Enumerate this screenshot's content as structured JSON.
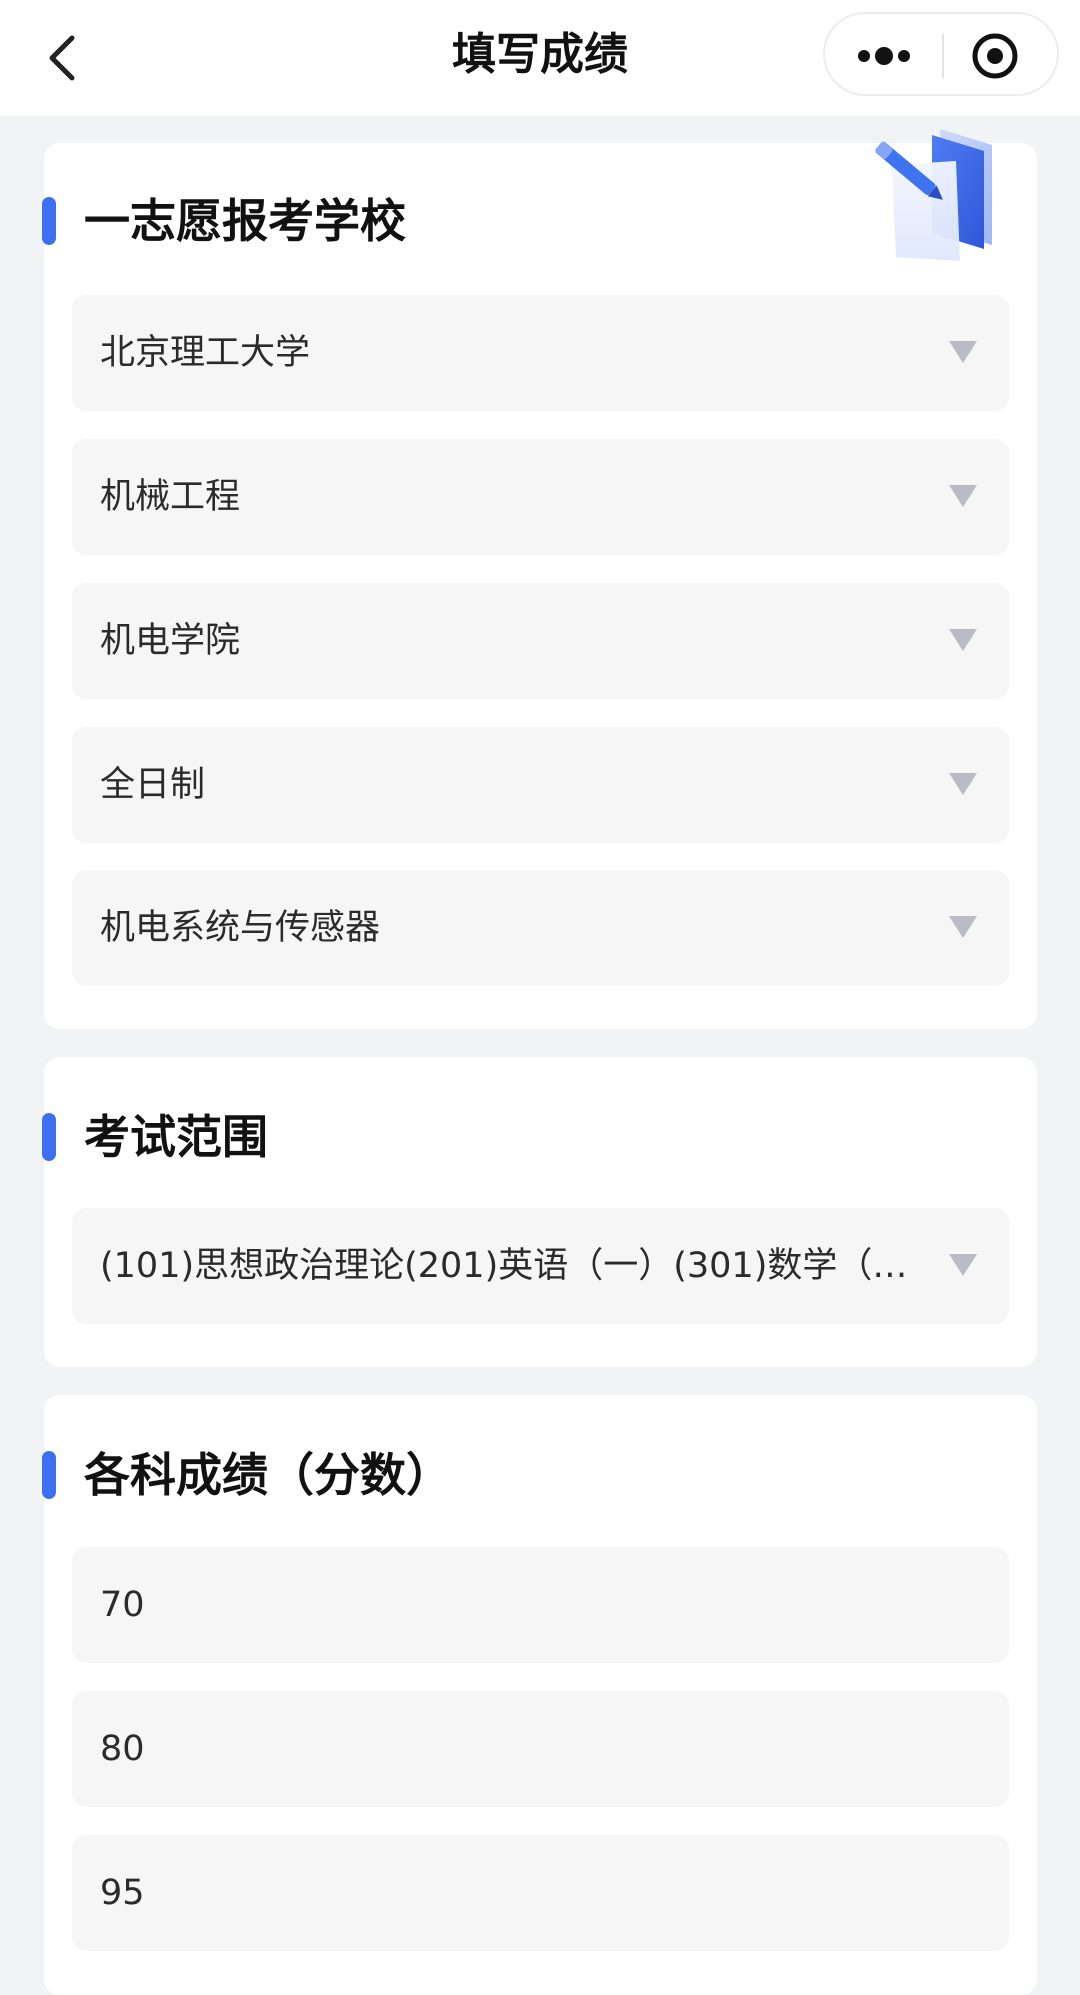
{
  "nav": {
    "title": "填写成绩"
  },
  "sections": {
    "school": {
      "title": "一志愿报考学校",
      "fields": [
        "北京理工大学",
        "机械工程",
        "机电学院",
        "全日制",
        "机电系统与传感器"
      ]
    },
    "exam": {
      "title": "考试范围",
      "value": "(101)思想政治理论(201)英语（一）(301)数学（一…"
    },
    "scores": {
      "title": "各科成绩（分数）",
      "values": [
        "70",
        "80",
        "95"
      ]
    }
  },
  "colors": {
    "accent": "#3d6ff2",
    "field_bg": "#f6f6f7",
    "page_bg": "#f2f3f5",
    "caret": "#b9bcc4"
  },
  "icons": [
    "back-arrow-icon",
    "more-dots-icon",
    "target-circle-icon",
    "dropdown-caret-icon",
    "document-pen-illustration"
  ]
}
